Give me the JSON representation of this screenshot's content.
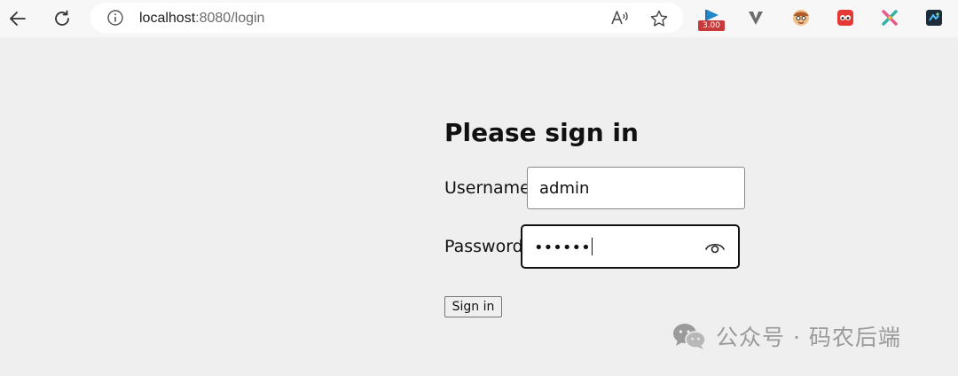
{
  "browser": {
    "url": {
      "host": "localhost",
      "rest": ":8080/login"
    },
    "extensions": [
      {
        "name": "blue-flag-extension",
        "badge": "3.00"
      },
      {
        "name": "v-extension"
      },
      {
        "name": "face-extension"
      },
      {
        "name": "red-ghost-extension"
      },
      {
        "name": "x-tool-extension"
      },
      {
        "name": "dark-square-extension"
      }
    ]
  },
  "login": {
    "title": "Please sign in",
    "username_label": "Username",
    "username_value": "admin",
    "password_label": "Password",
    "password_masked": "••••••",
    "submit_label": "Sign in"
  },
  "watermark": {
    "text": "公众号 · 码农后端"
  },
  "colors": {
    "page_bg": "#efefef",
    "toolbar_bg": "#f7f7f7",
    "text": "#111111",
    "badge_red": "#c83a3a"
  }
}
